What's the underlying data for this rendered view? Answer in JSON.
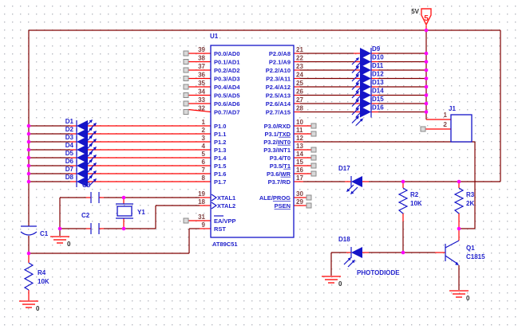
{
  "power": {
    "v5_label": "5V",
    "v5_flag": "5"
  },
  "ground_label": "0",
  "chip": {
    "ref": "U1",
    "part": "AT89C51",
    "p0_nums": [
      "39",
      "38",
      "37",
      "36",
      "35",
      "34",
      "33",
      "32"
    ],
    "p0_names": [
      "P0.0/AD0",
      "P0.1/AD1",
      "P0.2/AD2",
      "P0.3/AD3",
      "P0.4/AD4",
      "P0.5/AD5",
      "P0.6/AD6",
      "P0.7/AD7"
    ],
    "p2_nums": [
      "21",
      "22",
      "23",
      "24",
      "25",
      "26",
      "27",
      "28"
    ],
    "p2_names": [
      "P2.0/A8",
      "P2.1/A9",
      "P2.2/A10",
      "P2.3/A11",
      "P2.4/A12",
      "P2.5/A13",
      "P2.6/A14",
      "P2.7/A15"
    ],
    "p1_nums": [
      "1",
      "2",
      "3",
      "4",
      "5",
      "6",
      "7",
      "8"
    ],
    "p1_names": [
      "P1.0",
      "P1.1",
      "P1.2",
      "P1.3",
      "P1.4",
      "P1.5",
      "P1.6",
      "P1.7"
    ],
    "p3_nums": [
      "10",
      "11",
      "12",
      "13",
      "14",
      "15",
      "16",
      "17"
    ],
    "p3_pre": [
      "P3.0/RXD",
      "P3.1/",
      "P3.2/",
      "P3.3/INT1",
      "P3.4/T0",
      "P3.5/",
      "P3.6/",
      "P3.7/RD"
    ],
    "p3_dec": [
      "",
      "TXD",
      "INT0",
      "",
      "",
      "T1",
      "WR",
      ""
    ],
    "xtal1_num": "19",
    "xtal1": "XTAL1",
    "xtal2_num": "18",
    "xtal2": "XTAL2",
    "ale_num": "30",
    "ale_pre": "ALE/",
    "ale_dec": "PROG",
    "psen_num": "29",
    "psen": "PSEN",
    "ea_num": "31",
    "ea_dec": "EA",
    "ea_post": "/VPP",
    "rst_num": "9",
    "rst": "RST"
  },
  "leds_left": [
    "D1",
    "D2",
    "D3",
    "D4",
    "D5",
    "D6",
    "D7",
    "D8"
  ],
  "leds_right": [
    "D9",
    "D10",
    "D11",
    "D12",
    "D13",
    "D14",
    "D15",
    "D16"
  ],
  "d17": "D17",
  "d18": "D18",
  "photodiode_label": "PHOTODIODE",
  "r2": {
    "ref": "R2",
    "value": "10K"
  },
  "r3": {
    "ref": "R3",
    "value": "2K"
  },
  "r4": {
    "ref": "R4",
    "value": "10K"
  },
  "c1": "C1",
  "c2": "C2",
  "c3": "C3",
  "y1": "Y1",
  "j1": {
    "ref": "J1",
    "pin1": "1",
    "pin2": "2"
  },
  "q1": {
    "ref": "Q1",
    "part": "C1815"
  },
  "colors": {
    "wire": "#800000",
    "pin_stub": "#ff0000",
    "symbol": "#1414c8",
    "label": "#2222cc",
    "pin_number": "#804040",
    "junction": "#ff00ff",
    "ground": "#ff0000",
    "power_flag": "#ff2020"
  }
}
